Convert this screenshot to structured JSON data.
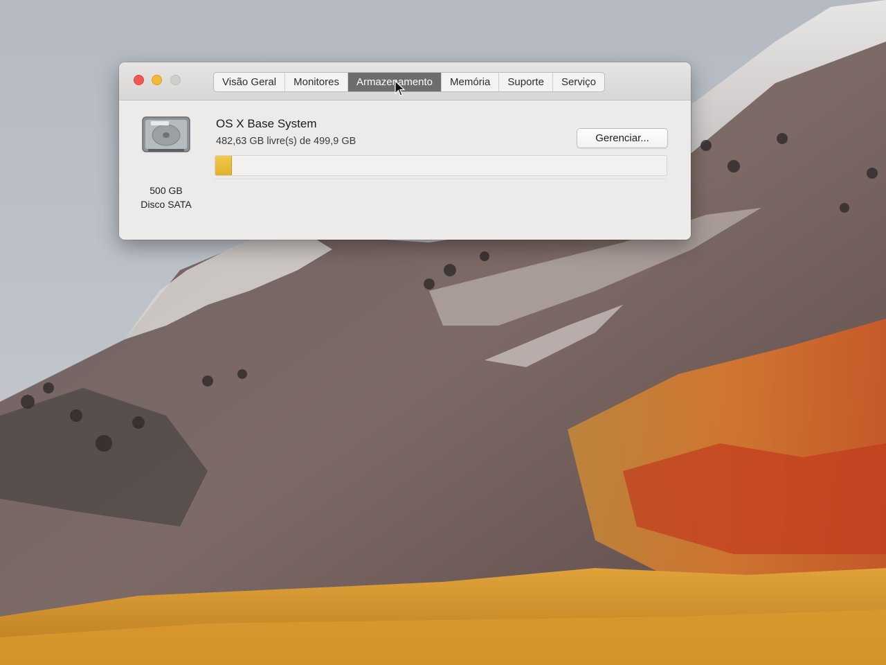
{
  "window": {
    "tabs": [
      {
        "label": "Visão Geral"
      },
      {
        "label": "Monitores"
      },
      {
        "label": "Armazenamento"
      },
      {
        "label": "Memória"
      },
      {
        "label": "Suporte"
      },
      {
        "label": "Serviço"
      }
    ],
    "active_tab": "Armazenamento"
  },
  "storage": {
    "disk_size": "500 GB",
    "disk_type": "Disco SATA",
    "volume_name": "OS X Base System",
    "free_text": "482,63 GB livre(s) de 499,9 GB",
    "used_fraction": 0.035,
    "manage_button": "Gerenciar..."
  },
  "colors": {
    "close": "#ee5a52",
    "minimize": "#f3b93a",
    "zoom_disabled": "#cfcecc",
    "active_tab": "#6d6d6d",
    "usage_fill": "#e3b02c"
  },
  "icons": {
    "disk": "hard-drive-icon",
    "pointer": "cursor-arrow-icon"
  }
}
